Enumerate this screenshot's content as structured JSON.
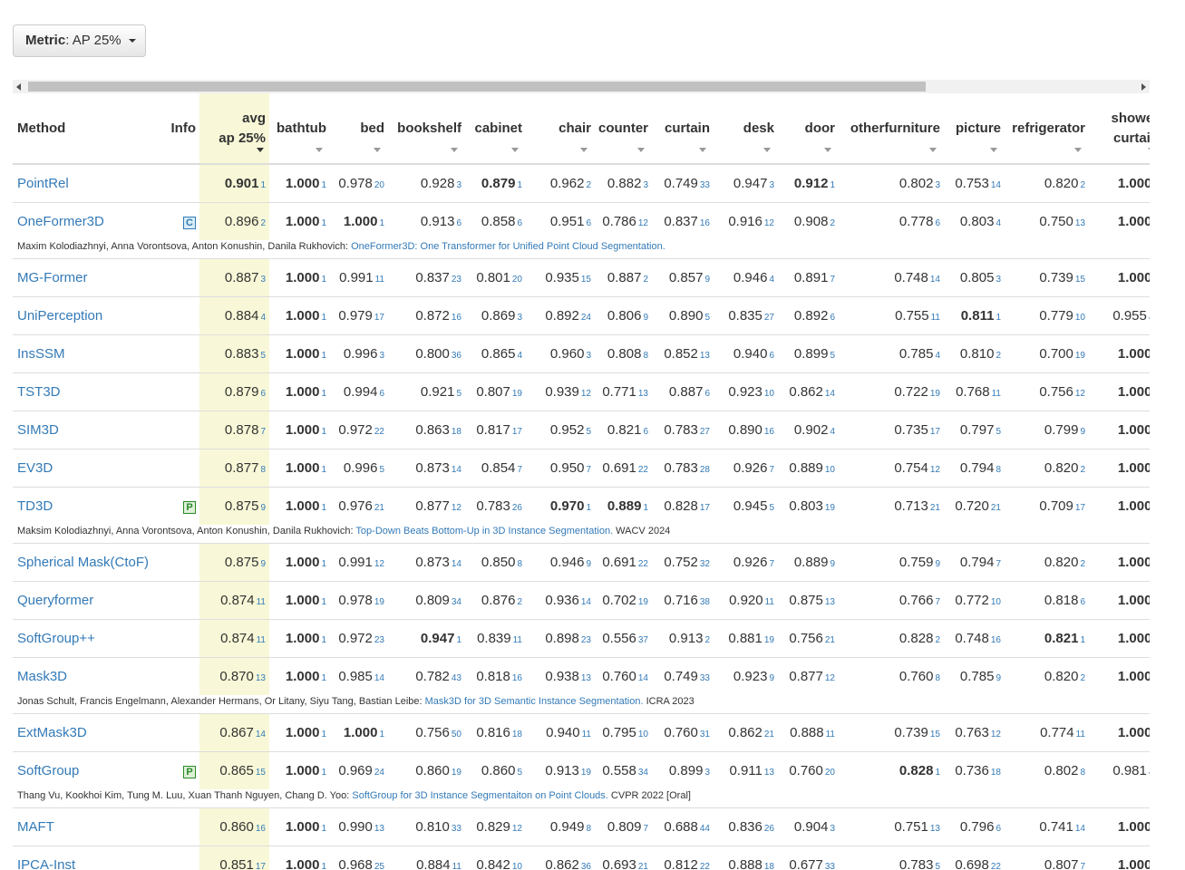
{
  "metric_button": {
    "label": "Metric",
    "value": ": AP 25%"
  },
  "columns": [
    "Method",
    "Info",
    "avg ap 25%",
    "bathtub",
    "bed",
    "bookshelf",
    "cabinet",
    "chair",
    "counter",
    "curtain",
    "desk",
    "door",
    "otherfurniture",
    "picture",
    "refrigerator",
    "shower curtain",
    "s"
  ],
  "header": {
    "method": "Method",
    "info": "Info",
    "avg_line1": "avg",
    "avg_line2": "ap 25%",
    "bathtub": "bathtub",
    "bed": "bed",
    "bookshelf": "bookshelf",
    "cabinet": "cabinet",
    "chair": "chair",
    "counter": "counter",
    "curtain": "curtain",
    "desk": "desk",
    "door": "door",
    "otherfurniture": "otherfurniture",
    "picture": "picture",
    "refrigerator": "refrigerator",
    "shower_line1": "shower",
    "shower_line2": "curtain"
  },
  "rows": [
    {
      "name": "PointRel",
      "badge": "",
      "avg": [
        "0.901",
        "1"
      ],
      "vals": [
        [
          "1.000",
          "1"
        ],
        [
          "0.978",
          "20"
        ],
        [
          "0.928",
          "3"
        ],
        [
          "0.879",
          "1"
        ],
        [
          "0.962",
          "2"
        ],
        [
          "0.882",
          "3"
        ],
        [
          "0.749",
          "33"
        ],
        [
          "0.947",
          "3"
        ],
        [
          "0.912",
          "1"
        ],
        [
          "0.802",
          "3"
        ],
        [
          "0.753",
          "14"
        ],
        [
          "0.820",
          "2"
        ],
        [
          "1.000",
          "1"
        ]
      ],
      "trail": "0",
      "cite": null
    },
    {
      "name": "OneFormer3D",
      "badge": "C",
      "avg": [
        "0.896",
        "2"
      ],
      "vals": [
        [
          "1.000",
          "1"
        ],
        [
          "1.000",
          "1"
        ],
        [
          "0.913",
          "6"
        ],
        [
          "0.858",
          "6"
        ],
        [
          "0.951",
          "6"
        ],
        [
          "0.786",
          "12"
        ],
        [
          "0.837",
          "16"
        ],
        [
          "0.916",
          "12"
        ],
        [
          "0.908",
          "2"
        ],
        [
          "0.778",
          "6"
        ],
        [
          "0.803",
          "4"
        ],
        [
          "0.750",
          "13"
        ],
        [
          "1.000",
          "1"
        ]
      ],
      "trail": "0",
      "cite": {
        "authors": "Maxim Kolodiazhnyi, Anna Vorontsova, Anton Konushin, Danila Rukhovich: ",
        "title": "OneFormer3D: One Transformer for Unified Point Cloud Segmentation.",
        "venue": ""
      }
    },
    {
      "name": "MG-Former",
      "badge": "",
      "avg": [
        "0.887",
        "3"
      ],
      "vals": [
        [
          "1.000",
          "1"
        ],
        [
          "0.991",
          "11"
        ],
        [
          "0.837",
          "23"
        ],
        [
          "0.801",
          "20"
        ],
        [
          "0.935",
          "15"
        ],
        [
          "0.887",
          "2"
        ],
        [
          "0.857",
          "9"
        ],
        [
          "0.946",
          "4"
        ],
        [
          "0.891",
          "7"
        ],
        [
          "0.748",
          "14"
        ],
        [
          "0.805",
          "3"
        ],
        [
          "0.739",
          "15"
        ],
        [
          "1.000",
          "1"
        ]
      ],
      "trail": "0",
      "cite": null
    },
    {
      "name": "UniPerception",
      "badge": "",
      "avg": [
        "0.884",
        "4"
      ],
      "vals": [
        [
          "1.000",
          "1"
        ],
        [
          "0.979",
          "17"
        ],
        [
          "0.872",
          "16"
        ],
        [
          "0.869",
          "3"
        ],
        [
          "0.892",
          "24"
        ],
        [
          "0.806",
          "9"
        ],
        [
          "0.890",
          "5"
        ],
        [
          "0.835",
          "27"
        ],
        [
          "0.892",
          "6"
        ],
        [
          "0.755",
          "11"
        ],
        [
          "0.811",
          "1"
        ],
        [
          "0.779",
          "10"
        ],
        [
          "0.955",
          "44"
        ]
      ],
      "trail": "0",
      "cite": null
    },
    {
      "name": "InsSSM",
      "badge": "",
      "avg": [
        "0.883",
        "5"
      ],
      "vals": [
        [
          "1.000",
          "1"
        ],
        [
          "0.996",
          "3"
        ],
        [
          "0.800",
          "36"
        ],
        [
          "0.865",
          "4"
        ],
        [
          "0.960",
          "3"
        ],
        [
          "0.808",
          "8"
        ],
        [
          "0.852",
          "13"
        ],
        [
          "0.940",
          "6"
        ],
        [
          "0.899",
          "5"
        ],
        [
          "0.785",
          "4"
        ],
        [
          "0.810",
          "2"
        ],
        [
          "0.700",
          "19"
        ],
        [
          "1.000",
          "1"
        ]
      ],
      "trail": "0.",
      "cite": null
    },
    {
      "name": "TST3D",
      "badge": "",
      "avg": [
        "0.879",
        "6"
      ],
      "vals": [
        [
          "1.000",
          "1"
        ],
        [
          "0.994",
          "6"
        ],
        [
          "0.921",
          "5"
        ],
        [
          "0.807",
          "19"
        ],
        [
          "0.939",
          "12"
        ],
        [
          "0.771",
          "13"
        ],
        [
          "0.887",
          "6"
        ],
        [
          "0.923",
          "10"
        ],
        [
          "0.862",
          "14"
        ],
        [
          "0.722",
          "19"
        ],
        [
          "0.768",
          "11"
        ],
        [
          "0.756",
          "12"
        ],
        [
          "1.000",
          "1"
        ]
      ],
      "trail": "0.",
      "cite": null
    },
    {
      "name": "SIM3D",
      "badge": "",
      "avg": [
        "0.878",
        "7"
      ],
      "vals": [
        [
          "1.000",
          "1"
        ],
        [
          "0.972",
          "22"
        ],
        [
          "0.863",
          "18"
        ],
        [
          "0.817",
          "17"
        ],
        [
          "0.952",
          "5"
        ],
        [
          "0.821",
          "6"
        ],
        [
          "0.783",
          "27"
        ],
        [
          "0.890",
          "16"
        ],
        [
          "0.902",
          "4"
        ],
        [
          "0.735",
          "17"
        ],
        [
          "0.797",
          "5"
        ],
        [
          "0.799",
          "9"
        ],
        [
          "1.000",
          "1"
        ]
      ],
      "trail": "0.",
      "cite": null
    },
    {
      "name": "EV3D",
      "badge": "",
      "avg": [
        "0.877",
        "8"
      ],
      "vals": [
        [
          "1.000",
          "1"
        ],
        [
          "0.996",
          "5"
        ],
        [
          "0.873",
          "14"
        ],
        [
          "0.854",
          "7"
        ],
        [
          "0.950",
          "7"
        ],
        [
          "0.691",
          "22"
        ],
        [
          "0.783",
          "28"
        ],
        [
          "0.926",
          "7"
        ],
        [
          "0.889",
          "10"
        ],
        [
          "0.754",
          "12"
        ],
        [
          "0.794",
          "8"
        ],
        [
          "0.820",
          "2"
        ],
        [
          "1.000",
          "1"
        ]
      ],
      "trail": "0.",
      "cite": null
    },
    {
      "name": "TD3D",
      "badge": "P",
      "avg": [
        "0.875",
        "9"
      ],
      "vals": [
        [
          "1.000",
          "1"
        ],
        [
          "0.976",
          "21"
        ],
        [
          "0.877",
          "12"
        ],
        [
          "0.783",
          "26"
        ],
        [
          "0.970",
          "1"
        ],
        [
          "0.889",
          "1"
        ],
        [
          "0.828",
          "17"
        ],
        [
          "0.945",
          "5"
        ],
        [
          "0.803",
          "19"
        ],
        [
          "0.713",
          "21"
        ],
        [
          "0.720",
          "21"
        ],
        [
          "0.709",
          "17"
        ],
        [
          "1.000",
          "1"
        ]
      ],
      "trail": "0.",
      "cite": {
        "authors": "Maksim Kolodiazhnyi, Anna Vorontsova, Anton Konushin, Danila Rukhovich: ",
        "title": "Top-Down Beats Bottom-Up in 3D Instance Segmentation.",
        "venue": " WACV 2024"
      }
    },
    {
      "name": "Spherical Mask(CtoF)",
      "badge": "",
      "avg": [
        "0.875",
        "9"
      ],
      "vals": [
        [
          "1.000",
          "1"
        ],
        [
          "0.991",
          "12"
        ],
        [
          "0.873",
          "14"
        ],
        [
          "0.850",
          "8"
        ],
        [
          "0.946",
          "9"
        ],
        [
          "0.691",
          "22"
        ],
        [
          "0.752",
          "32"
        ],
        [
          "0.926",
          "7"
        ],
        [
          "0.889",
          "9"
        ],
        [
          "0.759",
          "9"
        ],
        [
          "0.794",
          "7"
        ],
        [
          "0.820",
          "2"
        ],
        [
          "1.000",
          "1"
        ]
      ],
      "trail": "0.",
      "cite": null
    },
    {
      "name": "Queryformer",
      "badge": "",
      "avg": [
        "0.874",
        "11"
      ],
      "vals": [
        [
          "1.000",
          "1"
        ],
        [
          "0.978",
          "19"
        ],
        [
          "0.809",
          "34"
        ],
        [
          "0.876",
          "2"
        ],
        [
          "0.936",
          "14"
        ],
        [
          "0.702",
          "19"
        ],
        [
          "0.716",
          "38"
        ],
        [
          "0.920",
          "11"
        ],
        [
          "0.875",
          "13"
        ],
        [
          "0.766",
          "7"
        ],
        [
          "0.772",
          "10"
        ],
        [
          "0.818",
          "6"
        ],
        [
          "1.000",
          "1"
        ]
      ],
      "trail": "0",
      "cite": null
    },
    {
      "name": "SoftGroup++",
      "badge": "",
      "avg": [
        "0.874",
        "11"
      ],
      "vals": [
        [
          "1.000",
          "1"
        ],
        [
          "0.972",
          "23"
        ],
        [
          "0.947",
          "1"
        ],
        [
          "0.839",
          "11"
        ],
        [
          "0.898",
          "23"
        ],
        [
          "0.556",
          "37"
        ],
        [
          "0.913",
          "2"
        ],
        [
          "0.881",
          "19"
        ],
        [
          "0.756",
          "21"
        ],
        [
          "0.828",
          "2"
        ],
        [
          "0.748",
          "16"
        ],
        [
          "0.821",
          "1"
        ],
        [
          "1.000",
          "1"
        ]
      ],
      "trail": "0.",
      "cite": null
    },
    {
      "name": "Mask3D",
      "badge": "",
      "avg": [
        "0.870",
        "13"
      ],
      "vals": [
        [
          "1.000",
          "1"
        ],
        [
          "0.985",
          "14"
        ],
        [
          "0.782",
          "43"
        ],
        [
          "0.818",
          "16"
        ],
        [
          "0.938",
          "13"
        ],
        [
          "0.760",
          "14"
        ],
        [
          "0.749",
          "33"
        ],
        [
          "0.923",
          "9"
        ],
        [
          "0.877",
          "12"
        ],
        [
          "0.760",
          "8"
        ],
        [
          "0.785",
          "9"
        ],
        [
          "0.820",
          "2"
        ],
        [
          "1.000",
          "1"
        ]
      ],
      "trail": "0.",
      "cite": {
        "authors": "Jonas Schult, Francis Engelmann, Alexander Hermans, Or Litany, Siyu Tang, Bastian Leibe: ",
        "title": "Mask3D for 3D Semantic Instance Segmentation.",
        "venue": " ICRA 2023"
      }
    },
    {
      "name": "ExtMask3D",
      "badge": "",
      "avg": [
        "0.867",
        "14"
      ],
      "vals": [
        [
          "1.000",
          "1"
        ],
        [
          "1.000",
          "1"
        ],
        [
          "0.756",
          "50"
        ],
        [
          "0.816",
          "18"
        ],
        [
          "0.940",
          "11"
        ],
        [
          "0.795",
          "10"
        ],
        [
          "0.760",
          "31"
        ],
        [
          "0.862",
          "21"
        ],
        [
          "0.888",
          "11"
        ],
        [
          "0.739",
          "15"
        ],
        [
          "0.763",
          "12"
        ],
        [
          "0.774",
          "11"
        ],
        [
          "1.000",
          "1"
        ]
      ],
      "trail": "0.",
      "cite": null
    },
    {
      "name": "SoftGroup",
      "badge": "P",
      "avg": [
        "0.865",
        "15"
      ],
      "vals": [
        [
          "1.000",
          "1"
        ],
        [
          "0.969",
          "24"
        ],
        [
          "0.860",
          "19"
        ],
        [
          "0.860",
          "5"
        ],
        [
          "0.913",
          "19"
        ],
        [
          "0.558",
          "34"
        ],
        [
          "0.899",
          "3"
        ],
        [
          "0.911",
          "13"
        ],
        [
          "0.760",
          "20"
        ],
        [
          "0.828",
          "1"
        ],
        [
          "0.736",
          "18"
        ],
        [
          "0.802",
          "8"
        ],
        [
          "0.981",
          "41"
        ]
      ],
      "trail": "0.",
      "cite": {
        "authors": "Thang Vu, Kookhoi Kim, Tung M. Luu, Xuan Thanh Nguyen, Chang D. Yoo: ",
        "title": "SoftGroup for 3D Instance Segmentaiton on Point Clouds.",
        "venue": " CVPR 2022 [Oral]"
      }
    },
    {
      "name": "MAFT",
      "badge": "",
      "avg": [
        "0.860",
        "16"
      ],
      "vals": [
        [
          "1.000",
          "1"
        ],
        [
          "0.990",
          "13"
        ],
        [
          "0.810",
          "33"
        ],
        [
          "0.829",
          "12"
        ],
        [
          "0.949",
          "8"
        ],
        [
          "0.809",
          "7"
        ],
        [
          "0.688",
          "44"
        ],
        [
          "0.836",
          "26"
        ],
        [
          "0.904",
          "3"
        ],
        [
          "0.751",
          "13"
        ],
        [
          "0.796",
          "6"
        ],
        [
          "0.741",
          "14"
        ],
        [
          "1.000",
          "1"
        ]
      ],
      "trail": "0.",
      "cite": null
    },
    {
      "name": "IPCA-Inst",
      "badge": "",
      "avg": [
        "0.851",
        "17"
      ],
      "vals": [
        [
          "1.000",
          "1"
        ],
        [
          "0.968",
          "25"
        ],
        [
          "0.884",
          "11"
        ],
        [
          "0.842",
          "10"
        ],
        [
          "0.862",
          "36"
        ],
        [
          "0.693",
          "21"
        ],
        [
          "0.812",
          "22"
        ],
        [
          "0.888",
          "18"
        ],
        [
          "0.677",
          "33"
        ],
        [
          "0.783",
          "5"
        ],
        [
          "0.698",
          "22"
        ],
        [
          "0.807",
          "7"
        ],
        [
          "1.000",
          "1"
        ]
      ],
      "trail": "0",
      "cite": null
    }
  ]
}
